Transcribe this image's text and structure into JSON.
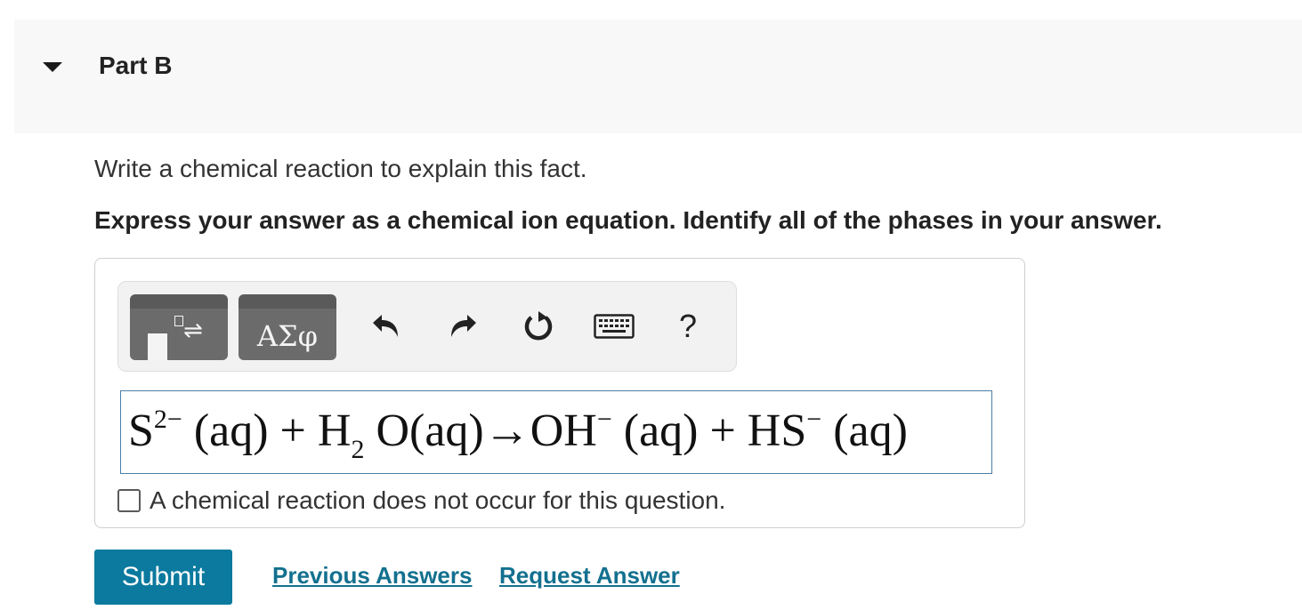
{
  "part": {
    "title": "Part B",
    "caret_icon": "caret-down-icon"
  },
  "question": {
    "instruction": "Write a chemical reaction to explain this fact.",
    "instruction_bold": "Express your answer as a chemical ion equation. Identify all of the phases in your answer."
  },
  "toolbar": {
    "templates_icon": "templates-icon",
    "greek_label": "ΑΣφ",
    "undo_icon": "undo-icon",
    "redo_icon": "redo-icon",
    "reset_icon": "reset-icon",
    "keyboard_icon": "keyboard-icon",
    "help_label": "?"
  },
  "equation": {
    "reactant1": "S",
    "reactant1_charge": "2−",
    "reactant1_phase": " (aq) + ",
    "reactant2_a": "H",
    "reactant2_sub": "2",
    "reactant2_b": " O(aq)→OH",
    "product1_charge": "−",
    "product1_phase": " (aq) + HS",
    "product2_charge": "−",
    "product2_phase": " (aq)"
  },
  "no_reaction": {
    "checked": false,
    "label": "A chemical reaction does not occur for this question."
  },
  "actions": {
    "submit_label": "Submit",
    "previous_answers_label": "Previous Answers",
    "request_answer_label": "Request Answer"
  },
  "colors": {
    "submit_bg": "#0b7a9e",
    "link": "#13708f",
    "field_border": "#4a7fa8"
  }
}
